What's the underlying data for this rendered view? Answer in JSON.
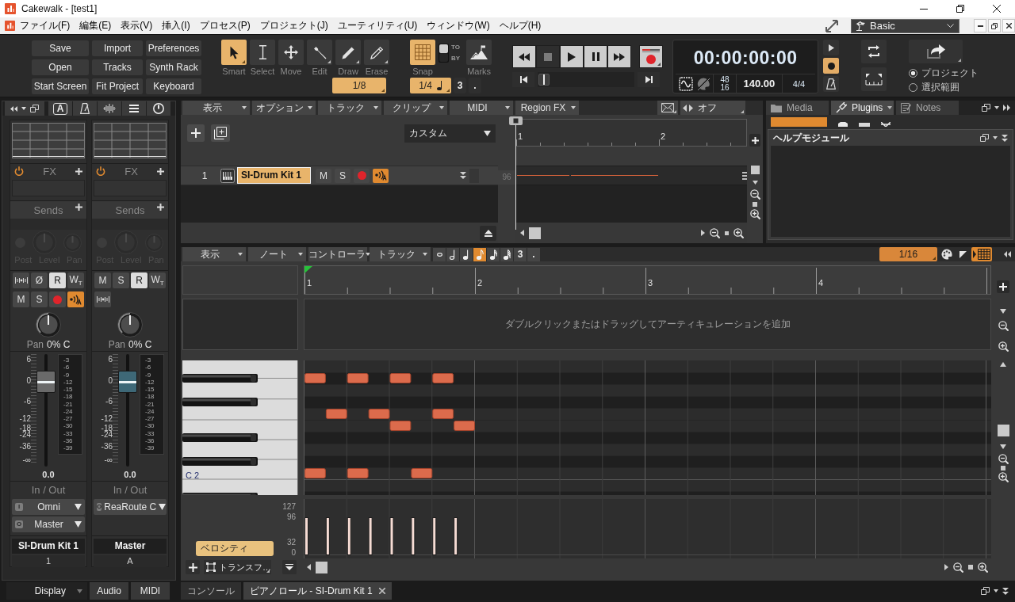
{
  "window": {
    "title": "Cakewalk - [test1]"
  },
  "menu_bar": {
    "items": [
      "ファイル(F)",
      "編集(E)",
      "表示(V)",
      "挿入(I)",
      "プロセス(P)",
      "プロジェクト(J)",
      "ユーティリティ(U)",
      "ウィンドウ(W)",
      "ヘルプ(H)"
    ],
    "workspace": "Basic"
  },
  "control_bar": {
    "quick_buttons": [
      "Save",
      "Import",
      "Preferences",
      "Open",
      "Tracks",
      "Synth Rack",
      "Start Screen",
      "Fit Project",
      "Keyboard"
    ],
    "tools": [
      {
        "kind": "smart",
        "label": "Smart",
        "selected": true
      },
      {
        "kind": "select",
        "label": "Select",
        "selected": false
      },
      {
        "kind": "move",
        "label": "Move",
        "selected": false
      },
      {
        "kind": "edit",
        "label": "Edit",
        "selected": false
      },
      {
        "kind": "draw",
        "label": "Draw",
        "selected": false
      },
      {
        "kind": "erase",
        "label": "Erase",
        "selected": false
      }
    ],
    "tool_resolution": "1/8",
    "snap": {
      "label": "Snap",
      "on": true,
      "modes": [
        {
          "label": "TO",
          "selected": true
        },
        {
          "label": "BY",
          "selected": false
        }
      ],
      "resolution": "1/4",
      "triplet": "3",
      "dotted": "."
    },
    "marks": {
      "label": "Marks"
    },
    "transport": [
      {
        "kind": "rewind",
        "selected": false
      },
      {
        "kind": "stop",
        "selected": true
      },
      {
        "kind": "play",
        "selected": false
      },
      {
        "kind": "pause",
        "selected": false
      },
      {
        "kind": "fast-forward",
        "selected": false
      }
    ],
    "now_slider": {
      "level": 0
    },
    "time_display": {
      "time": "00:00:00:00",
      "sample_rate": "48",
      "bit_depth": "16",
      "tempo": "140.00",
      "meter": "4/4"
    },
    "toggles": [
      {
        "kind": "play",
        "on": false
      },
      {
        "kind": "record",
        "on": true
      },
      {
        "kind": "metronome",
        "on": false
      }
    ],
    "export_scope": [
      {
        "label": "プロジェクト",
        "selected": true
      },
      {
        "label": "選択範囲",
        "selected": false
      }
    ]
  },
  "console": {
    "toolbar_letter": "A",
    "strips": [
      {
        "kind": "track",
        "fx_label": "FX",
        "fx_on": true,
        "sends_label": "Sends",
        "send_controls": [
          "Post",
          "Level",
          "Pan"
        ],
        "buttons": [
          {
            "kind": "monitor",
            "on": false
          },
          {
            "kind": "text",
            "label": "Ø",
            "on": false
          },
          {
            "kind": "text",
            "label": "R",
            "on": true
          },
          {
            "kind": "text",
            "label": "W$_{T}$",
            "on": false
          },
          {
            "kind": "text",
            "label": "M",
            "on": false
          },
          {
            "kind": "text",
            "label": "S",
            "on": false
          },
          {
            "kind": "record",
            "on": false
          },
          {
            "kind": "echo",
            "on": true
          }
        ],
        "pan_knob": {
          "level": 0.5
        },
        "pan_label": "Pan",
        "pan_value": "0% C",
        "scale": [
          "6",
          "0",
          "-6",
          "-12",
          "-18",
          "-24",
          "-36",
          "-∞"
        ],
        "fader": {
          "level": 0.75
        },
        "meter_scale": [
          "-3",
          "-6",
          "-9",
          "-12",
          "-15",
          "-18",
          "-21",
          "-24",
          "-27",
          "-30",
          "-33",
          "-36",
          "-39"
        ],
        "volume": "0.0",
        "io_label": "In / Out",
        "routes": [
          {
            "port": "I",
            "label": "Omni"
          },
          {
            "port": "O",
            "label": "Master"
          }
        ],
        "name": "SI-Drum Kit 1",
        "number": "1"
      },
      {
        "kind": "bus",
        "fx_label": "FX",
        "fx_on": true,
        "sends_label": "Sends",
        "send_controls": [
          "Post",
          "Level",
          "Pan"
        ],
        "buttons": [
          {
            "kind": "text",
            "label": "M",
            "on": false
          },
          {
            "kind": "text",
            "label": "S",
            "on": false
          },
          {
            "kind": "text",
            "label": "R",
            "on": true
          },
          {
            "kind": "text",
            "label": "W$_{T}$",
            "on": false
          },
          {
            "kind": "monitor",
            "on": false
          }
        ],
        "pan_knob": {
          "level": 0.5
        },
        "pan_label": "Pan",
        "pan_value": "0% C",
        "scale": [
          "6",
          "0",
          "-6",
          "-12",
          "-18",
          "-24",
          "-36",
          "-∞"
        ],
        "fader": {
          "level": 0.75
        },
        "meter_scale": [
          "-3",
          "-6",
          "-9",
          "-12",
          "-15",
          "-18",
          "-21",
          "-24",
          "-27",
          "-30",
          "-33",
          "-36",
          "-39"
        ],
        "volume": "0.0",
        "io_label": "In / Out",
        "routes": [
          {
            "port": "O",
            "label": "ReaRoute C"
          }
        ],
        "name": "Master",
        "number": "A"
      }
    ],
    "view_tabs": [
      {
        "kind": "dropdown",
        "label": "Display"
      },
      {
        "kind": "tab",
        "label": "Audio"
      },
      {
        "kind": "tab",
        "label": "MIDI"
      }
    ]
  },
  "track_view": {
    "menus": [
      "表示",
      "オプション",
      "トラック",
      "クリップ",
      "MIDI",
      "Region FX"
    ],
    "automation": "オフ",
    "preset": "カスタム",
    "ruler": [
      "1",
      "2"
    ],
    "tracks": [
      {
        "number": "1",
        "name": "SI-Drum Kit 1",
        "selected": true,
        "buttons": [
          {
            "kind": "text",
            "label": "M",
            "on": false
          },
          {
            "kind": "text",
            "label": "S",
            "on": false
          },
          {
            "kind": "record",
            "on": false
          },
          {
            "kind": "echo",
            "on": true
          }
        ]
      }
    ],
    "lane_value": "96"
  },
  "browser": {
    "tabs": [
      {
        "kind": "media",
        "label": "Media",
        "selected": false
      },
      {
        "kind": "plugins",
        "label": "Plugins",
        "selected": true
      },
      {
        "kind": "notes",
        "label": "Notes",
        "selected": false
      }
    ],
    "help_title": "ヘルプモジュール"
  },
  "piano_roll": {
    "menus": [
      "表示",
      "ノート",
      "コントローラ",
      "トラック"
    ],
    "durations": [
      {
        "kind": "whole",
        "selected": false
      },
      {
        "kind": "half",
        "selected": false
      },
      {
        "kind": "quarter",
        "selected": false
      },
      {
        "kind": "eighth",
        "selected": true
      },
      {
        "kind": "sixteenth",
        "selected": false
      },
      {
        "kind": "thirty-second",
        "selected": false
      }
    ],
    "triplet": "3",
    "dotted": ".",
    "snap": "1/16",
    "ruler": [
      "1",
      "2",
      "3",
      "4"
    ],
    "articulation_hint": "ダブルクリックまたはドラッグしてアーティキュレーションを追加",
    "key_label": "C 2",
    "controller_scale": [
      "127",
      "96",
      "32",
      "0"
    ],
    "controller": "ベロシティ",
    "tool": "トランスフ…"
  },
  "document_tabs": [
    {
      "label": "コンソール",
      "selected": false
    },
    {
      "label": "ピアノロール - SI-Drum Kit 1",
      "selected": true
    }
  ]
}
